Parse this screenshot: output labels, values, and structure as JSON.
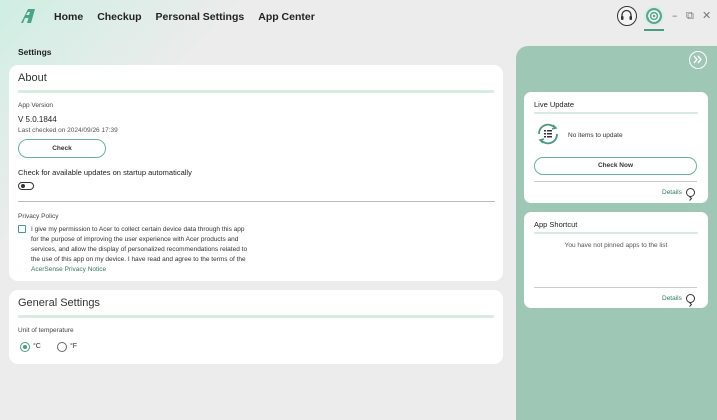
{
  "nav": {
    "logo": "a",
    "items": [
      "Home",
      "Checkup",
      "Personal Settings",
      "App Center"
    ]
  },
  "window_controls": {
    "minimize": "–",
    "restore": "⧉",
    "close": "✕"
  },
  "page_title": "Settings",
  "about": {
    "title": "About",
    "app_version_label": "App Version",
    "version": "V 5.0.1844",
    "last_checked": "Last checked on 2024/09/26 17:39",
    "check_button": "Check",
    "auto_update_label": "Check for available updates on startup automatically",
    "auto_update_enabled": false,
    "privacy_title": "Privacy Policy",
    "privacy_text_1": "I give my permission to Acer to collect certain device data through this app",
    "privacy_text_2": "for the purpose of improving the user experience with Acer products and",
    "privacy_text_3": "services, and allow the display of personalized recommendations related to",
    "privacy_text_4": "the use of this app on my device. I have read and agree to the terms of the",
    "privacy_link": "AcerSense Privacy Notice",
    "privacy_checked": false
  },
  "general": {
    "title": "General Settings",
    "unit_label": "Unit of temperature",
    "unit_c": "°C",
    "unit_f": "°F",
    "selected_unit": "°C"
  },
  "live_update": {
    "title": "Live Update",
    "status": "No items to update",
    "check_now": "Check Now",
    "details": "Details"
  },
  "app_shortcut": {
    "title": "App Shortcut",
    "empty_text": "You have not pinned apps to the list",
    "details": "Details"
  },
  "colors": {
    "accent": "#4a9b80",
    "panel": "#9ec8b5",
    "rule": "#d7ebe3"
  },
  "icons": [
    "acer-logo-icon",
    "headset-icon",
    "settings-icon",
    "minimize-icon",
    "restore-icon",
    "close-icon",
    "collapse-icon",
    "sync-list-icon",
    "chevron-right-icon"
  ]
}
